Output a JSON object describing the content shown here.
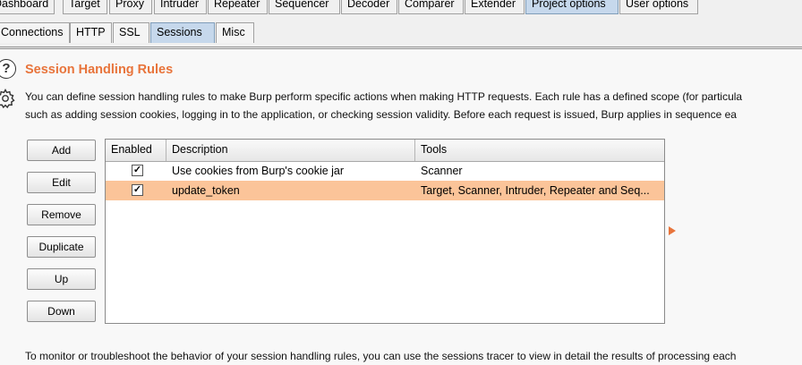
{
  "top_tabs": [
    "Dashboard",
    "Target",
    "Proxy",
    "Intruder",
    "Repeater",
    "Sequencer",
    "Decoder",
    "Comparer",
    "Extender",
    "Project options",
    "User options"
  ],
  "active_top_tab": "Project options",
  "sub_tabs": [
    "Connections",
    "HTTP",
    "SSL",
    "Sessions",
    "Misc"
  ],
  "active_sub_tab": "Sessions",
  "section": {
    "title": "Session Handling Rules",
    "desc_line1": "You can define session handling rules to make Burp perform specific actions when making HTTP requests. Each rule has a defined scope (for particula",
    "desc_line2": "such as adding session cookies, logging in to the application, or checking session validity. Before each request is issued, Burp applies in sequence ea"
  },
  "buttons": {
    "add": "Add",
    "edit": "Edit",
    "remove": "Remove",
    "duplicate": "Duplicate",
    "up": "Up",
    "down": "Down"
  },
  "table": {
    "columns": [
      "Enabled",
      "Description",
      "Tools"
    ],
    "rows": [
      {
        "enabled": true,
        "enabled_mark": "✓",
        "description": "Use cookies from Burp's cookie jar",
        "tools": "Scanner"
      },
      {
        "enabled": true,
        "enabled_mark": "✓",
        "description": "update_token",
        "tools": "Target, Scanner, Intruder, Repeater and Seq..."
      }
    ],
    "selected_row": 1
  },
  "footer_text": "To monitor or troubleshoot the behavior of your session handling rules, you can use the sessions tracer to view in detail the results of processing each",
  "colors": {
    "title": "#e8743b",
    "selected_row": "#fbc499",
    "active_tab": "#c6d8ec"
  },
  "icons": {
    "help": "help-icon",
    "settings": "gear-icon",
    "expand": "triangle-right-icon"
  }
}
